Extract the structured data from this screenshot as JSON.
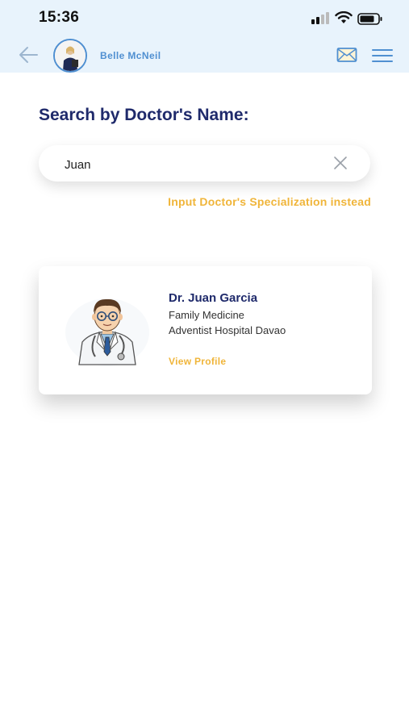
{
  "status_bar": {
    "time": "15:36",
    "signal_icon": "cellular-signal-icon",
    "wifi_icon": "wifi-icon",
    "battery_icon": "battery-icon"
  },
  "header": {
    "back_icon": "back-arrow-icon",
    "user_name": "Belle McNeil",
    "mail_icon": "envelope-icon",
    "menu_icon": "hamburger-menu-icon",
    "accent_color": "#4f8fd1"
  },
  "search": {
    "title": "Search by Doctor's Name:",
    "value": "Juan",
    "clear_icon": "close-icon",
    "alternate_link": "Input Doctor's Specialization instead"
  },
  "results": [
    {
      "name": "Dr. Juan Garcia",
      "specialization": "Family Medicine",
      "hospital": "Adventist Hospital Davao",
      "action": "View Profile"
    }
  ],
  "colors": {
    "heading": "#1f2a6b",
    "highlight": "#f0b53a",
    "header_bg": "#e8f3fc"
  }
}
